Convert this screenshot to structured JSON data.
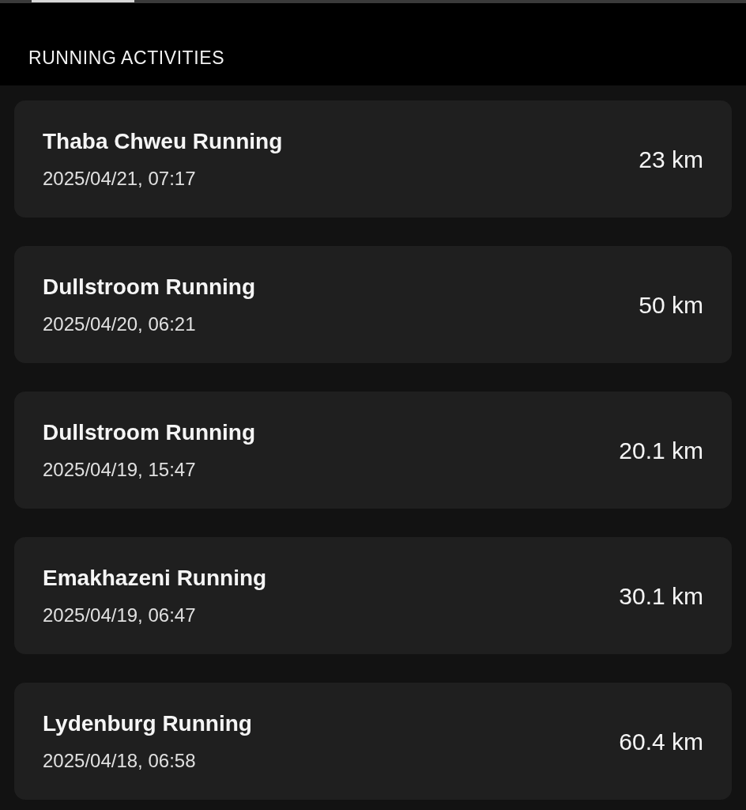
{
  "header": {
    "title": "RUNNING ACTIVITIES"
  },
  "activities": [
    {
      "name": "Thaba Chweu Running",
      "date": "2025/04/21, 07:17",
      "distance": "23 km"
    },
    {
      "name": "Dullstroom Running",
      "date": "2025/04/20, 06:21",
      "distance": "50 km"
    },
    {
      "name": "Dullstroom Running",
      "date": "2025/04/19, 15:47",
      "distance": "20.1 km"
    },
    {
      "name": "Emakhazeni Running",
      "date": "2025/04/19, 06:47",
      "distance": "30.1 km"
    },
    {
      "name": "Lydenburg Running",
      "date": "2025/04/18, 06:58",
      "distance": "60.4 km"
    }
  ]
}
